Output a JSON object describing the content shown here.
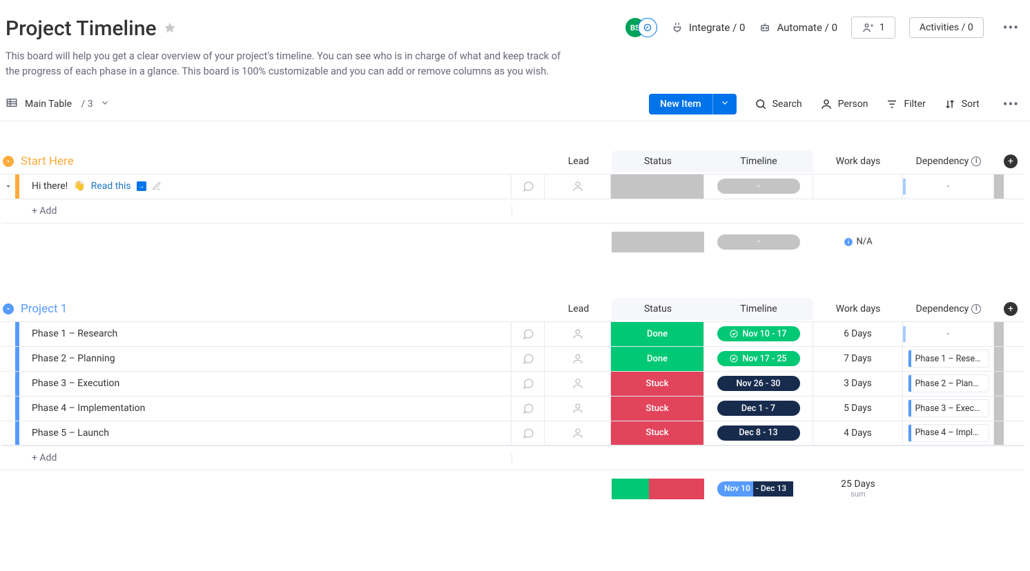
{
  "header": {
    "title": "Project Timeline",
    "description": "This board will help you get a clear overview of your project's timeline. You can see who is in charge of what and keep track of the progress of each phase in a glance. This board is 100% customizable and you can add or remove columns as you wish.",
    "avatar_initials": "BS",
    "integrate": {
      "label": "Integrate",
      "count": "0"
    },
    "automate": {
      "label": "Automate",
      "count": "0"
    },
    "invite": {
      "count": "1"
    },
    "activities": {
      "label": "Activities",
      "count": "0"
    }
  },
  "toolbar": {
    "view_label": "Main Table",
    "view_count": "3",
    "new_item": "New Item",
    "search": "Search",
    "person": "Person",
    "filter": "Filter",
    "sort": "Sort"
  },
  "columns": {
    "lead": "Lead",
    "status": "Status",
    "timeline": "Timeline",
    "workdays": "Work days",
    "dependency": "Dependency"
  },
  "add_row": "+ Add",
  "groups": [
    {
      "id": "g1",
      "title": "Start Here",
      "color": "#fdab3d",
      "items": [
        {
          "name_prefix": "Hi there!",
          "name_link": "Read this",
          "status": {
            "kind": "grey",
            "text": ""
          },
          "timeline": {
            "kind": "grey",
            "text": "-"
          },
          "workdays": "",
          "dependency": {
            "text": "-",
            "empty": true
          }
        }
      ],
      "summary": {
        "timeline_text": "-",
        "workdays": "N/A"
      }
    },
    {
      "id": "g2",
      "title": "Project 1",
      "color": "#579bfc",
      "items": [
        {
          "name": "Phase 1 – Research",
          "status": {
            "kind": "done",
            "text": "Done"
          },
          "timeline": {
            "kind": "green",
            "text": "Nov 10 - 17",
            "check": true
          },
          "workdays": "6 Days",
          "dependency": {
            "text": "-",
            "empty": true
          }
        },
        {
          "name": "Phase 2 – Planning",
          "status": {
            "kind": "done",
            "text": "Done"
          },
          "timeline": {
            "kind": "green",
            "text": "Nov 17 - 25",
            "check": true
          },
          "workdays": "7 Days",
          "dependency": {
            "text": "Phase 1 – Rese…"
          }
        },
        {
          "name": "Phase 3 – Execution",
          "status": {
            "kind": "stuck",
            "text": "Stuck"
          },
          "timeline": {
            "kind": "navy",
            "text": "Nov 26 - 30"
          },
          "workdays": "3 Days",
          "dependency": {
            "text": "Phase 2 – Plan…"
          }
        },
        {
          "name": "Phase 4 – Implementation",
          "status": {
            "kind": "stuck",
            "text": "Stuck"
          },
          "timeline": {
            "kind": "navy",
            "text": "Dec 1 - 7"
          },
          "workdays": "5 Days",
          "dependency": {
            "text": "Phase 3 – Exec…"
          }
        },
        {
          "name": "Phase 5 – Launch",
          "status": {
            "kind": "stuck",
            "text": "Stuck"
          },
          "timeline": {
            "kind": "navy",
            "text": "Dec 8 - 13"
          },
          "workdays": "4 Days",
          "dependency": {
            "text": "Phase 4 – Impl…"
          }
        }
      ],
      "summary": {
        "status_split": {
          "done_pct": 40,
          "stuck_pct": 60
        },
        "timeline_left": "Nov 10",
        "timeline_right": "- Dec 13",
        "workdays": "25 Days",
        "workdays_sub": "sum"
      }
    }
  ]
}
